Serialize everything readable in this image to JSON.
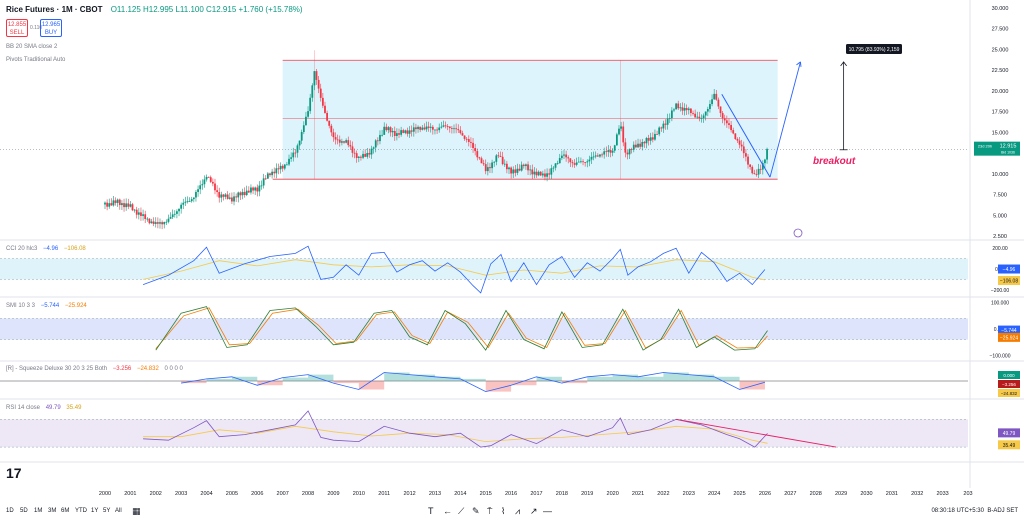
{
  "header": {
    "symbol": "Rice Futures · 1M · CBOT",
    "ohlc": "O11.125 H12.995 L11.100 C12.915 +1.760 (+15.78%)",
    "sell_price": "12.855",
    "sell_label": "SELL",
    "spread": "0.110",
    "buy_price": "12.965",
    "buy_label": "BUY",
    "bb_label": "BB 20 SMA close 2",
    "pivots_label": "Pivots Traditional Auto"
  },
  "chart_data": [
    {
      "type": "line",
      "panel": "price",
      "x": [
        2000.0,
        2000.5,
        2001.0,
        2001.5,
        2002.0,
        2002.5,
        2003.0,
        2003.5,
        2004.0,
        2004.5,
        2005.0,
        2005.5,
        2006.0,
        2006.5,
        2007.0,
        2007.5,
        2008.0,
        2008.25,
        2008.5,
        2009.0,
        2009.5,
        2010.0,
        2010.5,
        2011.0,
        2011.5,
        2012.0,
        2012.5,
        2013.0,
        2013.5,
        2014.0,
        2014.5,
        2015.0,
        2015.5,
        2016.0,
        2016.5,
        2017.0,
        2017.5,
        2018.0,
        2018.5,
        2019.0,
        2019.5,
        2020.0,
        2020.3,
        2020.5,
        2021.0,
        2021.5,
        2022.0,
        2022.5,
        2023.0,
        2023.5,
        2024.0,
        2024.3,
        2024.6,
        2025.0,
        2025.3,
        2025.6,
        2025.9,
        2026.1
      ],
      "y": [
        6.3,
        6.6,
        6.0,
        4.8,
        3.9,
        4.4,
        6.2,
        7.2,
        9.8,
        7.4,
        7.0,
        7.8,
        8.2,
        10.1,
        10.8,
        12.6,
        17.5,
        22.5,
        19.0,
        14.2,
        13.8,
        11.8,
        12.8,
        15.5,
        14.8,
        15.2,
        15.6,
        15.4,
        15.8,
        15.0,
        13.2,
        10.4,
        12.2,
        10.1,
        11.0,
        9.9,
        10.0,
        12.3,
        11.2,
        11.6,
        12.4,
        12.8,
        16.0,
        12.5,
        13.5,
        14.2,
        15.8,
        18.2,
        17.6,
        16.5,
        19.5,
        17.0,
        15.6,
        13.6,
        11.6,
        9.6,
        11.1,
        12.915
      ],
      "yticks": [
        "2.500",
        "5.000",
        "7.500",
        "10.000",
        "12.500",
        "15.000",
        "17.500",
        "20.000",
        "22.500",
        "25.000",
        "27.500",
        "30.000"
      ],
      "ylim": [
        2.5,
        30
      ],
      "xticks": [
        "2000",
        "2001",
        "2002",
        "2003",
        "2004",
        "2005",
        "2006",
        "2007",
        "2008",
        "2009",
        "2010",
        "2011",
        "2012",
        "2013",
        "2014",
        "2015",
        "2016",
        "2017",
        "2018",
        "2019",
        "2020",
        "2021",
        "2022",
        "2023",
        "2024",
        "2025",
        "2026",
        "2027",
        "2028",
        "2029",
        "2030",
        "2031",
        "2032",
        "2033",
        "203"
      ],
      "range_top": 23.7,
      "range_bottom": 9.35,
      "range_x": [
        2007.0,
        2026.5
      ],
      "mid_line": 16.7,
      "measure_label": "10.795 (83.93%) 2,159",
      "annotation": "breakout",
      "last_price": "12.915",
      "last_price_time": "23d 20h",
      "last_price_sub": "Bid 1036"
    },
    {
      "type": "line",
      "panel": "cci",
      "label": "CCI 20 hlc3",
      "value1": "−4.96",
      "value2": "−106.08",
      "yticks": [
        "200.00",
        "0.00",
        "−200.00"
      ],
      "ylim": [
        -260,
        260
      ],
      "x": [
        2001.5,
        2002.5,
        2003.5,
        2004.0,
        2004.5,
        2005.5,
        2006.5,
        2007.5,
        2008.0,
        2008.5,
        2009.0,
        2009.5,
        2010.0,
        2010.5,
        2011.0,
        2011.5,
        2012.0,
        2012.5,
        2013.0,
        2013.5,
        2014.0,
        2014.5,
        2014.8,
        2015.2,
        2015.6,
        2016.0,
        2016.5,
        2017.0,
        2017.5,
        2018.0,
        2018.5,
        2019.0,
        2019.5,
        2020.0,
        2020.3,
        2020.6,
        2021.0,
        2021.5,
        2022.0,
        2022.5,
        2023.0,
        2023.5,
        2024.0,
        2024.5,
        2025.0,
        2025.5,
        2026.0
      ],
      "y": [
        -150,
        -60,
        80,
        210,
        -40,
        50,
        120,
        150,
        220,
        -100,
        -80,
        40,
        -60,
        150,
        160,
        -30,
        40,
        80,
        -20,
        60,
        -30,
        -160,
        -230,
        50,
        140,
        -120,
        60,
        -150,
        40,
        120,
        -80,
        60,
        -20,
        100,
        190,
        -60,
        20,
        70,
        150,
        200,
        -40,
        160,
        60,
        -120,
        -40,
        -150,
        -5
      ],
      "x2": [
        2001.5,
        2003,
        2004.5,
        2006,
        2007.5,
        2009,
        2010.5,
        2012,
        2013.5,
        2015,
        2016.5,
        2018,
        2019.5,
        2021,
        2022.5,
        2024,
        2025.5,
        2026
      ],
      "y2": [
        -100,
        -20,
        80,
        30,
        90,
        40,
        20,
        40,
        30,
        -60,
        -10,
        -40,
        30,
        20,
        90,
        70,
        -80,
        -106
      ]
    },
    {
      "type": "line",
      "panel": "smi",
      "label": "SMI 10 3 3",
      "value1": "−5.744",
      "value2": "−25.924",
      "yticks": [
        "100.000",
        "0.000",
        "−100.000"
      ],
      "ylim": [
        -110,
        110
      ],
      "x": [
        2002.0,
        2003.0,
        2004.0,
        2004.8,
        2005.6,
        2006.5,
        2007.5,
        2008.3,
        2009.0,
        2009.8,
        2010.6,
        2011.3,
        2012.0,
        2012.7,
        2013.4,
        2014.2,
        2015.0,
        2015.8,
        2016.5,
        2017.3,
        2018.0,
        2018.8,
        2019.6,
        2020.4,
        2021.2,
        2021.9,
        2022.6,
        2023.3,
        2024.0,
        2024.8,
        2025.6,
        2026.1
      ],
      "y": [
        -80,
        60,
        85,
        -70,
        -60,
        70,
        80,
        10,
        -60,
        -50,
        60,
        70,
        -30,
        -60,
        70,
        20,
        -80,
        70,
        -40,
        -75,
        65,
        -70,
        -60,
        75,
        -80,
        -40,
        75,
        -70,
        -30,
        -80,
        -75,
        -6
      ],
      "x2": [
        2002.0,
        2003.1,
        2004.1,
        2004.9,
        2005.7,
        2006.6,
        2007.6,
        2008.4,
        2009.1,
        2009.9,
        2010.7,
        2011.4,
        2012.1,
        2012.8,
        2013.5,
        2014.3,
        2015.1,
        2015.9,
        2016.6,
        2017.4,
        2018.1,
        2018.9,
        2019.7,
        2020.5,
        2021.3,
        2022.0,
        2022.7,
        2023.4,
        2024.1,
        2024.9,
        2025.7,
        2026.1
      ],
      "y2": [
        -75,
        50,
        80,
        -60,
        -55,
        60,
        75,
        15,
        -55,
        -45,
        55,
        65,
        -25,
        -55,
        65,
        25,
        -70,
        60,
        -35,
        -70,
        60,
        -62,
        -55,
        70,
        -72,
        -35,
        70,
        -62,
        -25,
        -72,
        -70,
        -26
      ]
    },
    {
      "type": "area",
      "panel": "squeeze",
      "label": "[R] - Squeeze Deluxe 30 20 3 25 Both",
      "value1": "−3.256",
      "value2": "−24.832",
      "extra_values": [
        "0",
        "0",
        "0",
        "0"
      ],
      "box_values": [
        "0.000",
        "−3.256",
        "−24.832"
      ],
      "ylim": [
        -40,
        40
      ],
      "x": [
        2003.0,
        2004.0,
        2005.0,
        2006.0,
        2007.0,
        2008.0,
        2009.0,
        2010.0,
        2011.0,
        2012.0,
        2013.0,
        2014.0,
        2015.0,
        2016.0,
        2017.0,
        2018.0,
        2019.0,
        2020.0,
        2021.0,
        2022.0,
        2023.0,
        2024.0,
        2025.0,
        2026.0
      ],
      "y": [
        -5,
        5,
        10,
        -10,
        8,
        15,
        -5,
        -20,
        20,
        15,
        10,
        5,
        -25,
        -10,
        10,
        -5,
        10,
        15,
        10,
        20,
        15,
        10,
        -20,
        -3
      ]
    },
    {
      "type": "line",
      "panel": "rsi",
      "label": "RSI 14 close",
      "value1": "49.79",
      "value2": "35.49",
      "yticks": [],
      "ylim": [
        10,
        95
      ],
      "x": [
        2001.5,
        2002.5,
        2003.5,
        2004.0,
        2004.5,
        2005.5,
        2006.5,
        2007.5,
        2008.0,
        2008.5,
        2009.0,
        2010.0,
        2011.0,
        2012.0,
        2013.0,
        2014.0,
        2014.8,
        2015.2,
        2016.0,
        2017.0,
        2018.0,
        2019.0,
        2020.0,
        2020.3,
        2020.6,
        2021.5,
        2022.5,
        2023.5,
        2024.0,
        2024.5,
        2025.0,
        2025.6,
        2026.1
      ],
      "y": [
        42,
        40,
        58,
        68,
        45,
        48,
        55,
        62,
        82,
        44,
        40,
        38,
        60,
        50,
        45,
        50,
        30,
        32,
        48,
        35,
        55,
        45,
        58,
        72,
        48,
        55,
        70,
        62,
        55,
        48,
        42,
        30,
        49.8
      ],
      "x2": [
        2001.5,
        2003,
        2004.5,
        2006,
        2007.5,
        2009,
        2010.5,
        2012,
        2013.5,
        2015,
        2016.5,
        2018,
        2019.5,
        2021,
        2022.5,
        2024,
        2025.5,
        2026.1
      ],
      "y2": [
        45,
        45,
        55,
        50,
        60,
        52,
        46,
        50,
        48,
        38,
        42,
        44,
        48,
        52,
        60,
        56,
        40,
        35.5
      ]
    }
  ],
  "toolbar": {
    "timeframes": [
      "1D",
      "5D",
      "1M",
      "3M",
      "6M",
      "YTD",
      "1Y",
      "5Y",
      "All"
    ],
    "clock": "08:30:18 UTC+5:30",
    "flags": "B-ADJ  SET",
    "logo": "17"
  },
  "colors": {
    "up": "#089981",
    "down": "#f23645",
    "range_fill": "#d6f1fb",
    "range_line": "#f23645",
    "trend_line": "#2962ff",
    "cci": "#2962ff",
    "cci_signal": "#f7c948",
    "smi_fill": "#dde4fb",
    "rsi": "#7e57c2",
    "rsi_fill": "#ede7f6",
    "annotation": "#e91e63"
  }
}
